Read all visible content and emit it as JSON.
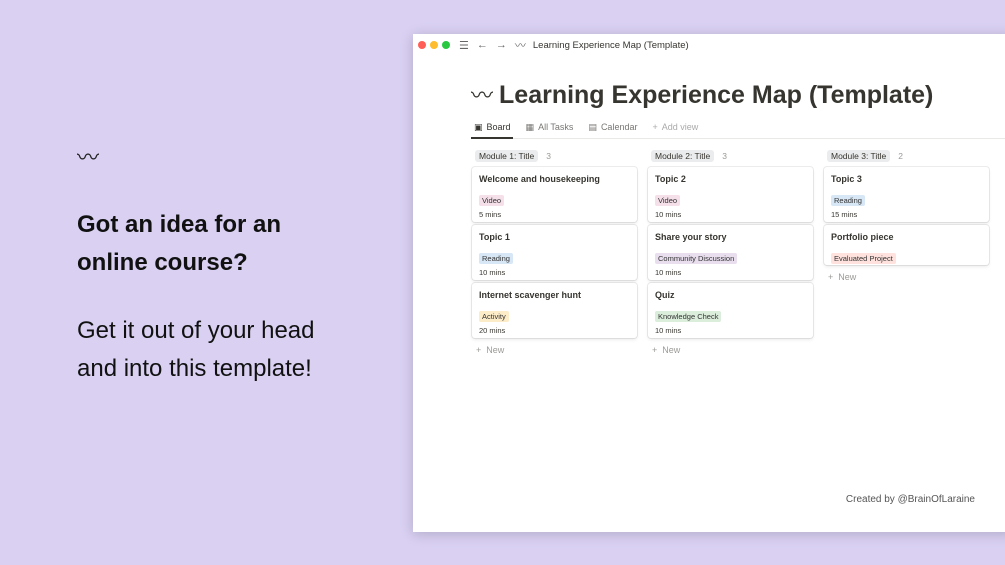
{
  "promo": {
    "icon": "〰",
    "heading_line1": "Got an idea for an",
    "heading_line2": "online course?",
    "body_line1": "Get it out of your head",
    "body_line2": "and into this template!"
  },
  "window": {
    "titlebar": {
      "menu_icon": "☰",
      "back_icon": "←",
      "forward_icon": "→",
      "page_icon": "〰",
      "title": "Learning Experience Map (Template)"
    },
    "page": {
      "icon": "〰",
      "title": "Learning Experience Map (Template)"
    },
    "views": [
      {
        "icon": "▣",
        "label": "Board"
      },
      {
        "icon": "▦",
        "label": "All Tasks"
      },
      {
        "icon": "▤",
        "label": "Calendar"
      },
      {
        "icon": "+",
        "label": "Add view"
      }
    ],
    "columns": [
      {
        "title": "Module 1: Title",
        "count": "3",
        "cards": [
          {
            "title": "Welcome and housekeeping",
            "tag": "Video",
            "duration": "5 mins"
          },
          {
            "title": "Topic 1",
            "tag": "Reading",
            "duration": "10 mins"
          },
          {
            "title": "Internet scavenger hunt",
            "tag": "Activity",
            "duration": "20 mins"
          }
        ],
        "new_label": "New"
      },
      {
        "title": "Module 2: Title",
        "count": "3",
        "cards": [
          {
            "title": "Topic 2",
            "tag": "Video",
            "duration": "10 mins"
          },
          {
            "title": "Share your story",
            "tag": "Community Discussion",
            "duration": "10 mins"
          },
          {
            "title": "Quiz",
            "tag": "Knowledge Check",
            "duration": "10 mins"
          }
        ],
        "new_label": "New"
      },
      {
        "title": "Module 3: Title",
        "count": "2",
        "cards": [
          {
            "title": "Topic 3",
            "tag": "Reading",
            "duration": "15 mins"
          },
          {
            "title": "Portfolio piece",
            "tag": "Evaluated Project",
            "duration": ""
          }
        ],
        "new_label": "New"
      }
    ],
    "credit": "Created by @BrainOfLaraine"
  },
  "colors": {
    "background": "#d9d0f2",
    "tag_video": "#f5dfe9",
    "tag_reading": "#d8e7f5",
    "tag_activity": "#fdecc8",
    "tag_community": "#e8deee",
    "tag_knowledge": "#dbeddb",
    "tag_evaluated": "#ffe2dd"
  }
}
